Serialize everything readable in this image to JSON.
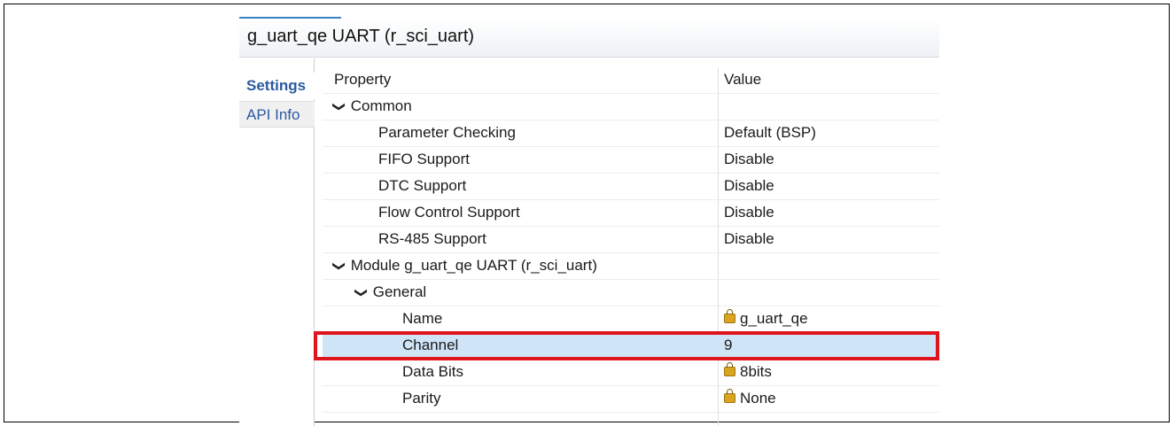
{
  "panel": {
    "title": "g_uart_qe UART (r_sci_uart)",
    "accent_color": "#3a83c4"
  },
  "tabs": [
    {
      "label": "Settings",
      "active": true
    },
    {
      "label": "API Info",
      "active": false
    }
  ],
  "table": {
    "headers": {
      "property": "Property",
      "value": "Value"
    },
    "rows": [
      {
        "property": "Common",
        "value": "",
        "level": 0,
        "expander": "chevron-down-icon"
      },
      {
        "property": "Parameter Checking",
        "value": "Default (BSP)",
        "level": 1
      },
      {
        "property": "FIFO Support",
        "value": "Disable",
        "level": 1
      },
      {
        "property": "DTC Support",
        "value": "Disable",
        "level": 1
      },
      {
        "property": "Flow Control Support",
        "value": "Disable",
        "level": 1
      },
      {
        "property": "RS-485 Support",
        "value": "Disable",
        "level": 1
      },
      {
        "property": "Module g_uart_qe UART (r_sci_uart)",
        "value": "",
        "level": 0,
        "expander": "chevron-down-icon"
      },
      {
        "property": "General",
        "value": "",
        "level": 1,
        "expander": "chevron-down-icon"
      },
      {
        "property": "Name",
        "value": "g_uart_qe",
        "level": 2,
        "locked": true
      },
      {
        "property": "Channel",
        "value": "9",
        "level": 2,
        "selected": true
      },
      {
        "property": "Data Bits",
        "value": "8bits",
        "level": 2,
        "locked": true
      },
      {
        "property": "Parity",
        "value": "None",
        "level": 2,
        "locked": true
      }
    ]
  },
  "colors": {
    "selection": "#cfe4f7",
    "highlight_border": "#e0141d"
  }
}
